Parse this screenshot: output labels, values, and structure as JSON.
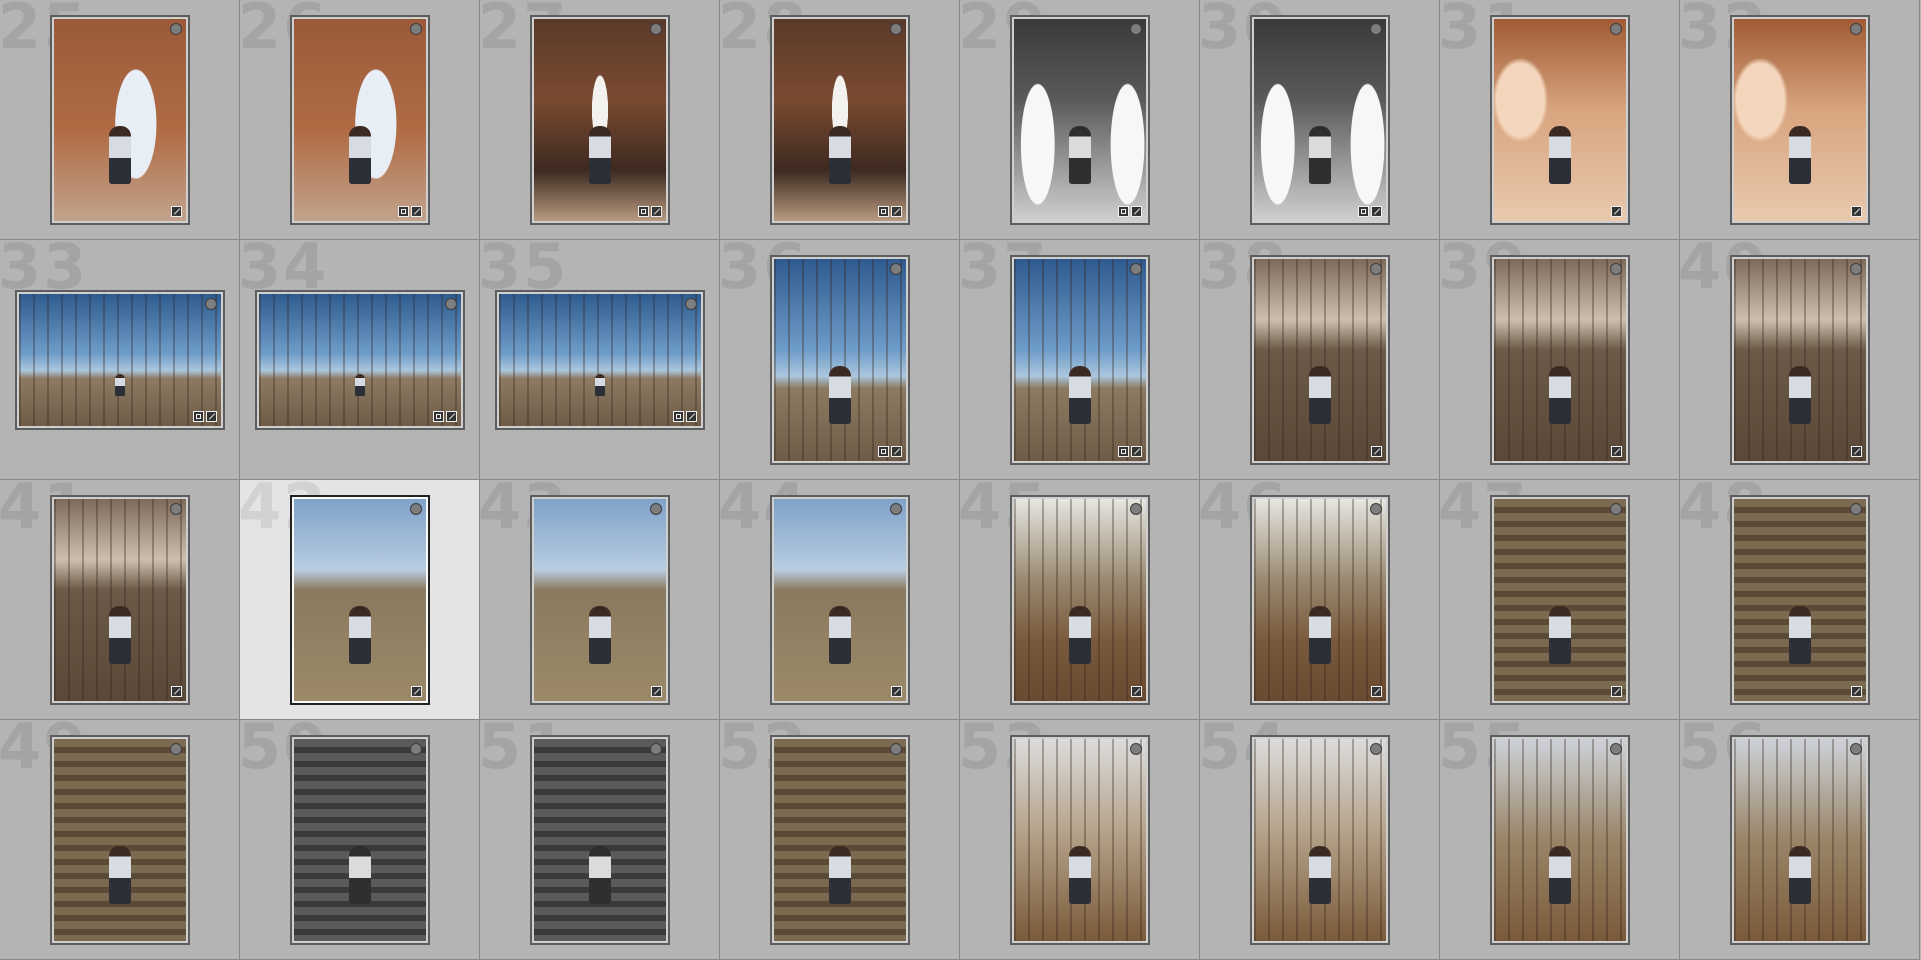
{
  "grid": {
    "cells": [
      {
        "num": "25",
        "orient": "portrait",
        "style": "brick",
        "badges": [
          "dev"
        ]
      },
      {
        "num": "26",
        "orient": "portrait",
        "style": "brick",
        "badges": [
          "crop",
          "dev"
        ]
      },
      {
        "num": "27",
        "orient": "portrait",
        "style": "arcade",
        "badges": [
          "crop",
          "dev"
        ]
      },
      {
        "num": "28",
        "orient": "portrait",
        "style": "arcade",
        "badges": [
          "crop",
          "dev"
        ]
      },
      {
        "num": "29",
        "orient": "portrait",
        "style": "bw",
        "badges": [
          "crop",
          "dev"
        ]
      },
      {
        "num": "30",
        "orient": "portrait",
        "style": "bw",
        "badges": [
          "crop",
          "dev"
        ]
      },
      {
        "num": "31",
        "orient": "portrait",
        "style": "warm",
        "badges": [
          "dev"
        ]
      },
      {
        "num": "32",
        "orient": "portrait",
        "style": "warm",
        "badges": [
          "dev"
        ]
      },
      {
        "num": "33",
        "orient": "landscape",
        "style": "sky",
        "badges": [
          "crop",
          "dev"
        ]
      },
      {
        "num": "34",
        "orient": "landscape",
        "style": "sky",
        "badges": [
          "crop",
          "dev"
        ]
      },
      {
        "num": "35",
        "orient": "landscape",
        "style": "sky",
        "badges": [
          "crop",
          "dev"
        ]
      },
      {
        "num": "36",
        "orient": "portrait",
        "style": "sky",
        "badges": [
          "crop",
          "dev"
        ]
      },
      {
        "num": "37",
        "orient": "portrait",
        "style": "sky",
        "badges": [
          "crop",
          "dev"
        ]
      },
      {
        "num": "38",
        "orient": "portrait",
        "style": "field",
        "badges": [
          "dev"
        ]
      },
      {
        "num": "39",
        "orient": "portrait",
        "style": "field",
        "badges": [
          "dev"
        ]
      },
      {
        "num": "40",
        "orient": "portrait",
        "style": "field",
        "badges": [
          "dev"
        ]
      },
      {
        "num": "41",
        "orient": "portrait",
        "style": "field",
        "badges": [
          "dev"
        ]
      },
      {
        "num": "42",
        "orient": "portrait",
        "style": "lightsky",
        "badges": [
          "dev"
        ],
        "selected": true
      },
      {
        "num": "43",
        "orient": "portrait",
        "style": "lightsky",
        "badges": [
          "dev"
        ]
      },
      {
        "num": "44",
        "orient": "portrait",
        "style": "lightsky",
        "badges": [
          "dev"
        ]
      },
      {
        "num": "45",
        "orient": "portrait",
        "style": "forest",
        "badges": [
          "dev"
        ]
      },
      {
        "num": "46",
        "orient": "portrait",
        "style": "forest",
        "badges": [
          "dev"
        ]
      },
      {
        "num": "47",
        "orient": "portrait",
        "style": "stairs",
        "badges": [
          "dev"
        ]
      },
      {
        "num": "48",
        "orient": "portrait",
        "style": "stairs",
        "badges": [
          "dev"
        ]
      },
      {
        "num": "49",
        "orient": "portrait",
        "style": "stairs",
        "badges": []
      },
      {
        "num": "50",
        "orient": "portrait",
        "style": "stairs-bw",
        "badges": []
      },
      {
        "num": "51",
        "orient": "portrait",
        "style": "stairs-bw",
        "badges": []
      },
      {
        "num": "52",
        "orient": "portrait",
        "style": "stairs",
        "badges": []
      },
      {
        "num": "53",
        "orient": "portrait",
        "style": "bare",
        "badges": []
      },
      {
        "num": "54",
        "orient": "portrait",
        "style": "bare",
        "badges": []
      },
      {
        "num": "55",
        "orient": "portrait",
        "style": "trees",
        "badges": []
      },
      {
        "num": "56",
        "orient": "portrait",
        "style": "trees",
        "badges": []
      }
    ]
  }
}
